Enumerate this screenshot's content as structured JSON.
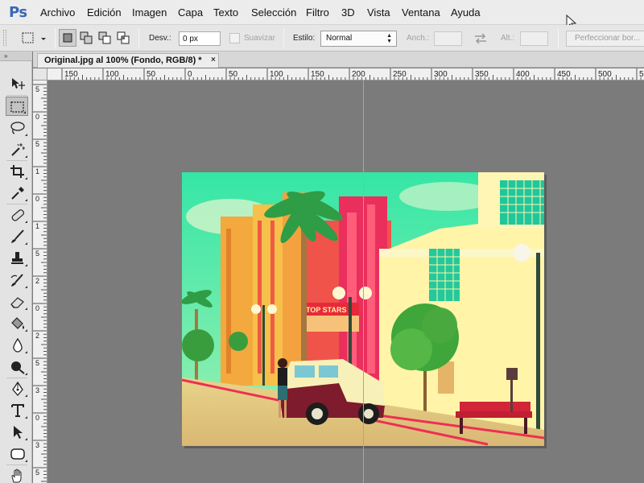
{
  "app": {
    "logo": "Ps"
  },
  "menu": {
    "items": [
      "Archivo",
      "Edición",
      "Imagen",
      "Capa",
      "Texto",
      "Selección",
      "Filtro",
      "3D",
      "Vista",
      "Ventana",
      "Ayuda"
    ]
  },
  "options": {
    "feather_label": "Desv.:",
    "feather_value": "0 px",
    "antialias_label": "Suavizar",
    "style_label": "Estilo:",
    "style_value": "Normal",
    "width_label": "Anch.:",
    "height_label": "Alt.:",
    "refine_edge_label": "Perfeccionar bor..."
  },
  "toolbar": {
    "collapse_label": "»"
  },
  "document": {
    "tab_title": "Original.jpg al 100% (Fondo, RGB/8) *",
    "close_label": "×"
  },
  "rulers": {
    "horizontal": [
      "150",
      "100",
      "50",
      "0",
      "50",
      "100",
      "150",
      "200",
      "250",
      "300",
      "350",
      "400",
      "450",
      "500",
      "550"
    ],
    "vertical": [
      "5",
      "0",
      "5",
      "1",
      "0",
      "1",
      "5",
      "2",
      "0",
      "2",
      "5",
      "3",
      "0",
      "3",
      "5"
    ]
  },
  "photo": {
    "sign_text": "TOP STARS"
  },
  "colors": {
    "guide": "#28d8f0",
    "pasteboard": "#7b7b7b",
    "ps_logo": "#3b66b8"
  }
}
